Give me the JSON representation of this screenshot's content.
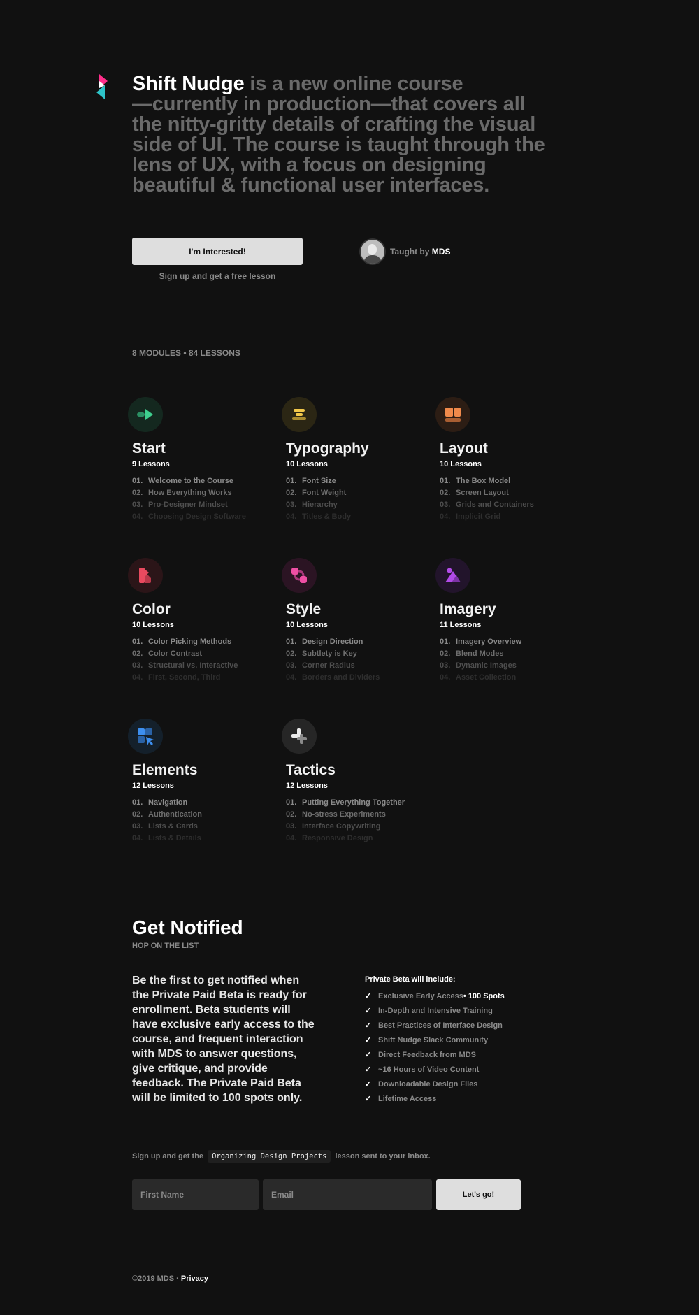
{
  "intro": {
    "brand": "Shift Nudge",
    "line1_rest": " is a new online course",
    "line2": "—currently in production—that covers all",
    "line3": "the nitty-gritty details of crafting the visual",
    "line4": "side of UI. The course is taught through the",
    "line5": "lens of UX, with a focus on designing",
    "line6": "beautiful & functional user interfaces."
  },
  "cta": {
    "button": "I'm Interested!",
    "sub": "Sign up and get a free lesson"
  },
  "teacher": {
    "prefix": "Taught by ",
    "name": "MDS"
  },
  "modules_summary": "8 MODULES • 84 LESSONS",
  "modules": [
    {
      "title": "Start",
      "count": "9 Lessons",
      "icon": "play-icon",
      "color": "#3ecf8e",
      "lessons": [
        {
          "num": "01.",
          "name": "Welcome to the Course"
        },
        {
          "num": "02.",
          "name": "How Everything Works"
        },
        {
          "num": "03.",
          "name": "Pro-Designer Mindset"
        },
        {
          "num": "04.",
          "name": "Choosing Design Software"
        }
      ]
    },
    {
      "title": "Typography",
      "count": "10 Lessons",
      "icon": "text-lines-icon",
      "color": "#f2c84b",
      "lessons": [
        {
          "num": "01.",
          "name": "Font Size"
        },
        {
          "num": "02.",
          "name": "Font Weight"
        },
        {
          "num": "03.",
          "name": "Hierarchy"
        },
        {
          "num": "04.",
          "name": "Titles & Body"
        }
      ]
    },
    {
      "title": "Layout",
      "count": "10 Lessons",
      "icon": "layout-blocks-icon",
      "color": "#f08a4b",
      "lessons": [
        {
          "num": "01.",
          "name": "The Box Model"
        },
        {
          "num": "02.",
          "name": "Screen Layout"
        },
        {
          "num": "03.",
          "name": "Grids and Containers"
        },
        {
          "num": "04.",
          "name": "Implicit Grid"
        }
      ]
    },
    {
      "title": "Color",
      "count": "10 Lessons",
      "icon": "color-swatch-icon",
      "color": "#e84a5f",
      "lessons": [
        {
          "num": "01.",
          "name": "Color Picking Methods"
        },
        {
          "num": "02.",
          "name": "Color Contrast"
        },
        {
          "num": "03.",
          "name": "Structural vs. Interactive"
        },
        {
          "num": "04.",
          "name": "First, Second, Third"
        }
      ]
    },
    {
      "title": "Style",
      "count": "10 Lessons",
      "icon": "style-shapes-icon",
      "color": "#ee4fa4",
      "lessons": [
        {
          "num": "01.",
          "name": "Design Direction"
        },
        {
          "num": "02.",
          "name": "Subtlety is Key"
        },
        {
          "num": "03.",
          "name": "Corner Radius"
        },
        {
          "num": "04.",
          "name": "Borders and Dividers"
        }
      ]
    },
    {
      "title": "Imagery",
      "count": "11 Lessons",
      "icon": "image-mountain-icon",
      "color": "#b24be8",
      "lessons": [
        {
          "num": "01.",
          "name": "Imagery Overview"
        },
        {
          "num": "02.",
          "name": "Blend Modes"
        },
        {
          "num": "03.",
          "name": "Dynamic Images"
        },
        {
          "num": "04.",
          "name": "Asset Collection"
        }
      ]
    },
    {
      "title": "Elements",
      "count": "12 Lessons",
      "icon": "elements-cursor-icon",
      "color": "#3d8ff0",
      "lessons": [
        {
          "num": "01.",
          "name": "Navigation"
        },
        {
          "num": "02.",
          "name": "Authentication"
        },
        {
          "num": "03.",
          "name": "Lists & Cards"
        },
        {
          "num": "04.",
          "name": "Lists & Details"
        }
      ]
    },
    {
      "title": "Tactics",
      "count": "12 Lessons",
      "icon": "tactics-plus-icon",
      "color": "#dcdcdc",
      "lessons": [
        {
          "num": "01.",
          "name": "Putting Everything Together"
        },
        {
          "num": "02.",
          "name": "No-stress Experiments"
        },
        {
          "num": "03.",
          "name": "Interface Copywriting"
        },
        {
          "num": "04.",
          "name": "Responsive Design"
        }
      ]
    }
  ],
  "notify": {
    "title": "Get Notified",
    "subtitle": "HOP ON THE LIST",
    "body_lines": [
      "Be the first to get notified when",
      "the Private Paid Beta is ready for",
      "enrollment. Beta students will",
      "have exclusive early access to the",
      "course, and frequent interaction",
      "with MDS to answer questions,",
      "give critique, and provide",
      "feedback. The Private Paid Beta",
      "will be limited to 100 spots only."
    ],
    "beta_heading": "Private Beta will include:",
    "beta_items": [
      "Exclusive Early Access",
      "In-Depth and Intensive Training",
      "Best Practices of Interface Design",
      "Shift Nudge Slack Community",
      "Direct Feedback from MDS",
      "~16 Hours of Video Content",
      "Downloadable Design Files",
      "Lifetime Access"
    ],
    "beta_spots": " • 100 Spots"
  },
  "signup": {
    "prefix": "Sign up and get the",
    "lesson": "Organizing Design Projects",
    "suffix": "lesson sent to your inbox.",
    "first_name_placeholder": "First Name",
    "email_placeholder": "Email",
    "button": "Let's go!"
  },
  "footer": {
    "copyright": "©2019 MDS · ",
    "privacy": "Privacy"
  },
  "colors": {
    "background": "#111111",
    "muted_text": "#8a8a8a",
    "button_bg": "#dedede",
    "brand_pink": "#ff2e8a",
    "brand_teal": "#2ec4c9"
  }
}
